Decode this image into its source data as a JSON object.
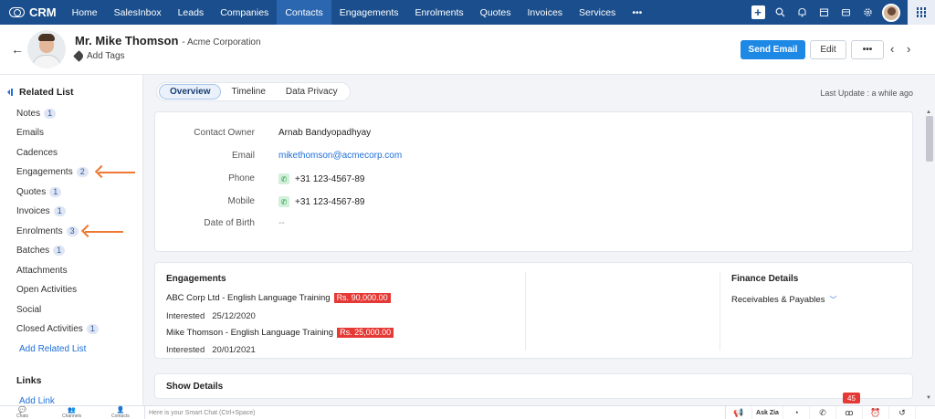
{
  "app": {
    "brand": "CRM",
    "nav_tabs": [
      "Home",
      "SalesInbox",
      "Leads",
      "Companies",
      "Contacts",
      "Engagements",
      "Enrolments",
      "Quotes",
      "Invoices",
      "Services",
      "•••"
    ],
    "active_tab": "Contacts",
    "accent_color": "#1a4e8c"
  },
  "header": {
    "name": "Mr. Mike Thomson",
    "company": "- Acme Corporation",
    "add_tags": "Add Tags",
    "send_email": "Send Email",
    "edit": "Edit",
    "more": "•••",
    "prev": "‹",
    "next": "›",
    "back": "←"
  },
  "sidebar": {
    "title": "Related List",
    "items": [
      {
        "label": "Notes",
        "count": "1"
      },
      {
        "label": "Emails",
        "count": ""
      },
      {
        "label": "Cadences",
        "count": ""
      },
      {
        "label": "Engagements",
        "count": "2"
      },
      {
        "label": "Quotes",
        "count": "1"
      },
      {
        "label": "Invoices",
        "count": "1"
      },
      {
        "label": "Enrolments",
        "count": "3"
      },
      {
        "label": "Batches",
        "count": "1"
      },
      {
        "label": "Attachments",
        "count": ""
      },
      {
        "label": "Open Activities",
        "count": ""
      },
      {
        "label": "Social",
        "count": ""
      },
      {
        "label": "Closed Activities",
        "count": "1"
      }
    ],
    "add_related_list": "Add Related List",
    "links_title": "Links",
    "add_link": "Add Link"
  },
  "tabs": [
    "Overview",
    "Timeline",
    "Data Privacy"
  ],
  "active_subtab": "Overview",
  "last_update": "Last Update : a while ago",
  "overview": {
    "contact_owner_label": "Contact Owner",
    "contact_owner": "Arnab Bandyopadhyay",
    "email_label": "Email",
    "email": "mikethomson@acmecorp.com",
    "phone_label": "Phone",
    "phone": "+31 123-4567-89",
    "mobile_label": "Mobile",
    "mobile": "+31 123-4567-89",
    "dob_label": "Date of Birth",
    "dob": "--"
  },
  "engagements": {
    "title": "Engagements",
    "items": [
      {
        "title": "ABC Corp Ltd - English Language Training",
        "amount": "Rs. 90,000.00",
        "status": "Interested",
        "date": "25/12/2020"
      },
      {
        "title": "Mike Thomson - English Language Training",
        "amount": "Rs. 25,000.00",
        "status": "Interested",
        "date": "20/01/2021"
      }
    ],
    "amount_color": "#e53935"
  },
  "finance": {
    "title": "Finance Details",
    "sub": "Receivables & Payables"
  },
  "show_details": "Show Details",
  "bottom": {
    "chats": "Chats",
    "channels": "Channels",
    "contacts": "Contacts",
    "chat_placeholder": "Here is your Smart Chat (Ctrl+Space)",
    "ask_zia": "Ask Zia",
    "notif_count": "45"
  }
}
